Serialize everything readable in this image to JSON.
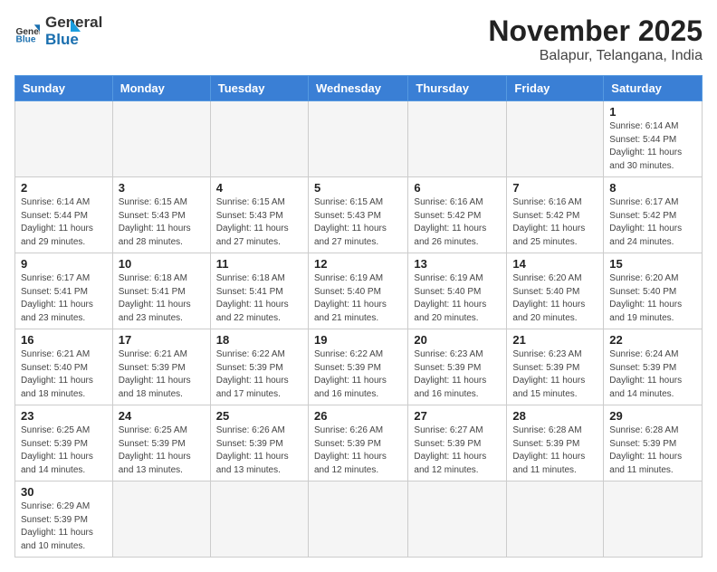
{
  "header": {
    "logo_general": "General",
    "logo_blue": "Blue",
    "month_title": "November 2025",
    "subtitle": "Balapur, Telangana, India"
  },
  "weekdays": [
    "Sunday",
    "Monday",
    "Tuesday",
    "Wednesday",
    "Thursday",
    "Friday",
    "Saturday"
  ],
  "weeks": [
    [
      {
        "day": "",
        "info": ""
      },
      {
        "day": "",
        "info": ""
      },
      {
        "day": "",
        "info": ""
      },
      {
        "day": "",
        "info": ""
      },
      {
        "day": "",
        "info": ""
      },
      {
        "day": "",
        "info": ""
      },
      {
        "day": "1",
        "info": "Sunrise: 6:14 AM\nSunset: 5:44 PM\nDaylight: 11 hours\nand 30 minutes."
      }
    ],
    [
      {
        "day": "2",
        "info": "Sunrise: 6:14 AM\nSunset: 5:44 PM\nDaylight: 11 hours\nand 29 minutes."
      },
      {
        "day": "3",
        "info": "Sunrise: 6:15 AM\nSunset: 5:43 PM\nDaylight: 11 hours\nand 28 minutes."
      },
      {
        "day": "4",
        "info": "Sunrise: 6:15 AM\nSunset: 5:43 PM\nDaylight: 11 hours\nand 27 minutes."
      },
      {
        "day": "5",
        "info": "Sunrise: 6:15 AM\nSunset: 5:43 PM\nDaylight: 11 hours\nand 27 minutes."
      },
      {
        "day": "6",
        "info": "Sunrise: 6:16 AM\nSunset: 5:42 PM\nDaylight: 11 hours\nand 26 minutes."
      },
      {
        "day": "7",
        "info": "Sunrise: 6:16 AM\nSunset: 5:42 PM\nDaylight: 11 hours\nand 25 minutes."
      },
      {
        "day": "8",
        "info": "Sunrise: 6:17 AM\nSunset: 5:42 PM\nDaylight: 11 hours\nand 24 minutes."
      }
    ],
    [
      {
        "day": "9",
        "info": "Sunrise: 6:17 AM\nSunset: 5:41 PM\nDaylight: 11 hours\nand 23 minutes."
      },
      {
        "day": "10",
        "info": "Sunrise: 6:18 AM\nSunset: 5:41 PM\nDaylight: 11 hours\nand 23 minutes."
      },
      {
        "day": "11",
        "info": "Sunrise: 6:18 AM\nSunset: 5:41 PM\nDaylight: 11 hours\nand 22 minutes."
      },
      {
        "day": "12",
        "info": "Sunrise: 6:19 AM\nSunset: 5:40 PM\nDaylight: 11 hours\nand 21 minutes."
      },
      {
        "day": "13",
        "info": "Sunrise: 6:19 AM\nSunset: 5:40 PM\nDaylight: 11 hours\nand 20 minutes."
      },
      {
        "day": "14",
        "info": "Sunrise: 6:20 AM\nSunset: 5:40 PM\nDaylight: 11 hours\nand 20 minutes."
      },
      {
        "day": "15",
        "info": "Sunrise: 6:20 AM\nSunset: 5:40 PM\nDaylight: 11 hours\nand 19 minutes."
      }
    ],
    [
      {
        "day": "16",
        "info": "Sunrise: 6:21 AM\nSunset: 5:40 PM\nDaylight: 11 hours\nand 18 minutes."
      },
      {
        "day": "17",
        "info": "Sunrise: 6:21 AM\nSunset: 5:39 PM\nDaylight: 11 hours\nand 18 minutes."
      },
      {
        "day": "18",
        "info": "Sunrise: 6:22 AM\nSunset: 5:39 PM\nDaylight: 11 hours\nand 17 minutes."
      },
      {
        "day": "19",
        "info": "Sunrise: 6:22 AM\nSunset: 5:39 PM\nDaylight: 11 hours\nand 16 minutes."
      },
      {
        "day": "20",
        "info": "Sunrise: 6:23 AM\nSunset: 5:39 PM\nDaylight: 11 hours\nand 16 minutes."
      },
      {
        "day": "21",
        "info": "Sunrise: 6:23 AM\nSunset: 5:39 PM\nDaylight: 11 hours\nand 15 minutes."
      },
      {
        "day": "22",
        "info": "Sunrise: 6:24 AM\nSunset: 5:39 PM\nDaylight: 11 hours\nand 14 minutes."
      }
    ],
    [
      {
        "day": "23",
        "info": "Sunrise: 6:25 AM\nSunset: 5:39 PM\nDaylight: 11 hours\nand 14 minutes."
      },
      {
        "day": "24",
        "info": "Sunrise: 6:25 AM\nSunset: 5:39 PM\nDaylight: 11 hours\nand 13 minutes."
      },
      {
        "day": "25",
        "info": "Sunrise: 6:26 AM\nSunset: 5:39 PM\nDaylight: 11 hours\nand 13 minutes."
      },
      {
        "day": "26",
        "info": "Sunrise: 6:26 AM\nSunset: 5:39 PM\nDaylight: 11 hours\nand 12 minutes."
      },
      {
        "day": "27",
        "info": "Sunrise: 6:27 AM\nSunset: 5:39 PM\nDaylight: 11 hours\nand 12 minutes."
      },
      {
        "day": "28",
        "info": "Sunrise: 6:28 AM\nSunset: 5:39 PM\nDaylight: 11 hours\nand 11 minutes."
      },
      {
        "day": "29",
        "info": "Sunrise: 6:28 AM\nSunset: 5:39 PM\nDaylight: 11 hours\nand 11 minutes."
      }
    ],
    [
      {
        "day": "30",
        "info": "Sunrise: 6:29 AM\nSunset: 5:39 PM\nDaylight: 11 hours\nand 10 minutes."
      },
      {
        "day": "",
        "info": ""
      },
      {
        "day": "",
        "info": ""
      },
      {
        "day": "",
        "info": ""
      },
      {
        "day": "",
        "info": ""
      },
      {
        "day": "",
        "info": ""
      },
      {
        "day": "",
        "info": ""
      }
    ]
  ]
}
